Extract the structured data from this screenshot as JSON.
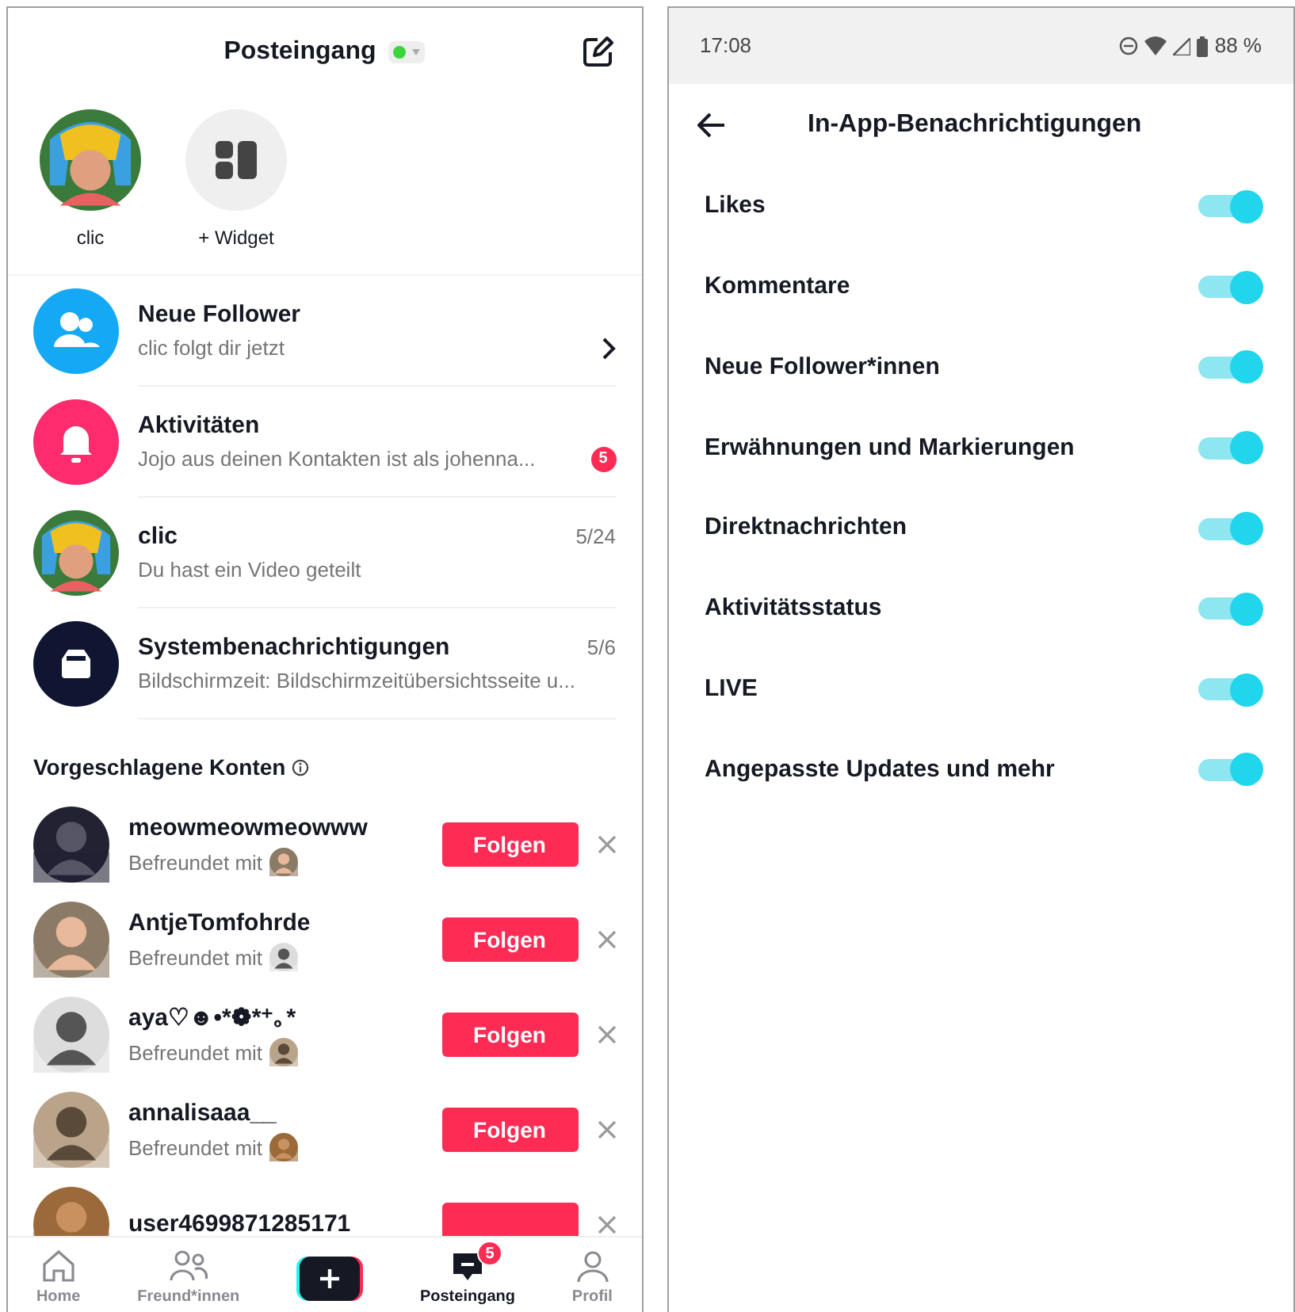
{
  "inbox": {
    "title": "Posteingang",
    "online": true,
    "stories": [
      {
        "kind": "avatar",
        "label": "clic"
      },
      {
        "kind": "widget",
        "label": "+ Widget"
      }
    ],
    "messages": [
      {
        "kind": "followers",
        "title": "Neue Follower",
        "subtitle": "clic folgt dir jetzt"
      },
      {
        "kind": "activity",
        "title": "Aktivitäten",
        "subtitle": "Jojo aus deinen Kontakten ist als johenna...",
        "badge": "5"
      },
      {
        "kind": "avatar",
        "title": "clic",
        "subtitle": "Du hast ein Video geteilt",
        "date": "5/24"
      },
      {
        "kind": "system",
        "title": "Systembenachrichtigungen",
        "subtitle": "Bildschirmzeit: Bildschirmzeitübersichtsseite u...",
        "date": "5/6"
      }
    ],
    "suggested_heading": "Vorgeschlagene Konten",
    "accounts": [
      {
        "name": "meowmeowmeowww",
        "subtitle": "Befreundet mit",
        "button": "Folgen"
      },
      {
        "name": "AntjeTomfohrde",
        "subtitle": "Befreundet mit",
        "button": "Folgen"
      },
      {
        "name": "aya♡☻•*❁*⁺｡*",
        "subtitle": "Befreundet mit",
        "button": "Folgen"
      },
      {
        "name": "annalisaaa__",
        "subtitle": "Befreundet mit",
        "button": "Folgen"
      },
      {
        "name": "user4699871285171"
      }
    ],
    "nav": [
      {
        "kind": "home",
        "label": "Home",
        "selected": false
      },
      {
        "kind": "friends",
        "label": "Freund*innen",
        "selected": false
      },
      {
        "kind": "create"
      },
      {
        "kind": "inbox",
        "label": "Posteingang",
        "selected": true,
        "badge": "5"
      },
      {
        "kind": "profile",
        "label": "Profil",
        "selected": false
      }
    ]
  },
  "settings": {
    "status_bar": {
      "time": "17:08",
      "battery": "88 %"
    },
    "title": "In-App-Benachrichtigungen",
    "toggles": [
      {
        "label": "Likes",
        "on": true
      },
      {
        "label": "Kommentare",
        "on": true
      },
      {
        "label": "Neue Follower*innen",
        "on": true
      },
      {
        "label": "Erwähnungen und Markierungen",
        "on": true
      },
      {
        "label": "Direktnachrichten",
        "on": true
      },
      {
        "label": "Aktivitätsstatus",
        "on": true
      },
      {
        "label": "LIVE",
        "on": true
      },
      {
        "label": "Angepasste Updates und mehr",
        "on": true
      }
    ]
  }
}
